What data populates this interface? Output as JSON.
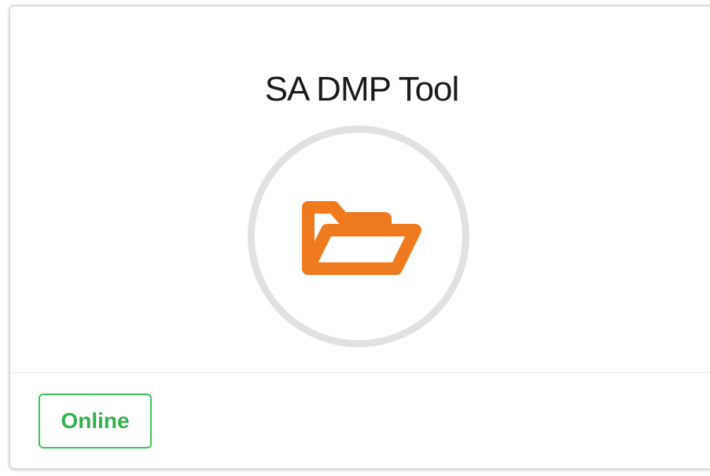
{
  "card": {
    "title": "SA DMP Tool",
    "icon": "folder-open-icon",
    "status": "Online"
  },
  "colors": {
    "icon": "#F07A1E",
    "ring": "#E1E1E1",
    "status": "#33B04F"
  }
}
